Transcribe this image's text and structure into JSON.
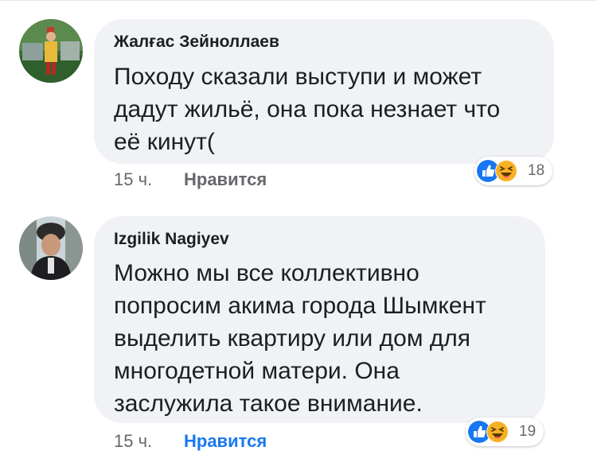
{
  "comments": [
    {
      "author": "Жалғас Зейноллаев",
      "lines": [
        "Походу сказали выступи и может",
        "дадут жильё, она пока незнает что",
        "её кинут("
      ],
      "time": "15 ч.",
      "like_label": "Нравится",
      "like_color": "#65676b",
      "reactions": [
        "like-icon",
        "haha-icon"
      ],
      "reaction_count": "18"
    },
    {
      "author": "Izgilik Nagiyev",
      "lines": [
        "Можно мы все коллективно",
        "попросим акима города Шымкент",
        "выделить квартиру или дом для",
        "многодетной матери. Она",
        "заслужила такое внимание."
      ],
      "time": "15 ч.",
      "like_label": "Нравится",
      "like_color": "#1877f2",
      "reactions": [
        "like-icon",
        "haha-icon"
      ],
      "reaction_count": "19"
    }
  ],
  "colors": {
    "bubble": "#f0f2f5",
    "text": "#1c1e21",
    "muted": "#65676b",
    "like_blue": "#1877f2",
    "haha_yellow": "#f7b125"
  }
}
